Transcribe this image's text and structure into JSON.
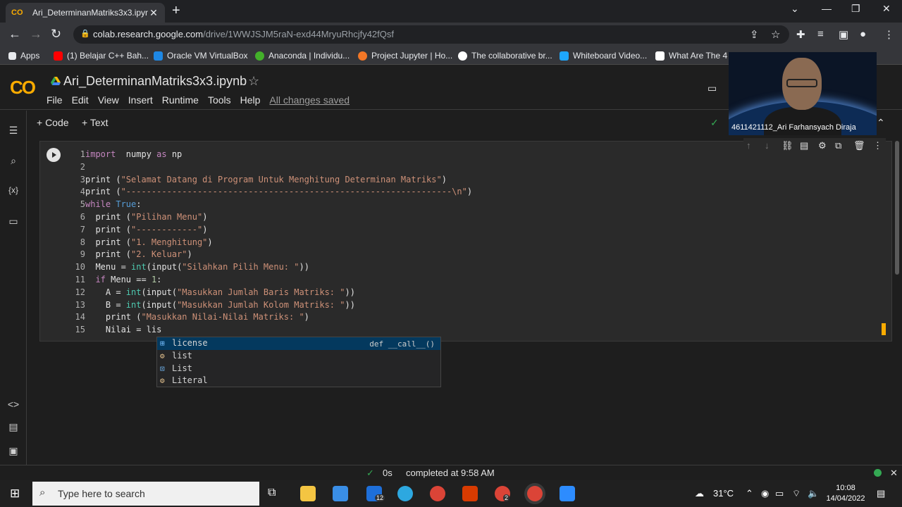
{
  "browser": {
    "tab_title": "Ari_DeterminanMatriks3x3.ipynb",
    "tab_logo": "CO",
    "url_domain": "colab.research.google.com",
    "url_path": "/drive/1WWJSJM5raN-exd44MryuRhcjfy42fQsf"
  },
  "bookmarks": [
    {
      "label": "Apps",
      "color": "#e8eaed"
    },
    {
      "label": "(1) Belajar C++ Bah...",
      "color": "#ff0000"
    },
    {
      "label": "Oracle VM VirtualBox",
      "color": "#1e88e5"
    },
    {
      "label": "Anaconda | Individu...",
      "color": "#43b02a"
    },
    {
      "label": "Project Jupyter | Ho...",
      "color": "#f37726"
    },
    {
      "label": "The collaborative br...",
      "color": "#ffffff"
    },
    {
      "label": "Whiteboard Video...",
      "color": "#1ea7fd"
    },
    {
      "label": "What Are The 4 D",
      "color": "#ffffff"
    }
  ],
  "colab": {
    "logo": "CO",
    "notebook_title": "Ari_DeterminanMatriks3x3.ipynb",
    "menu": [
      "File",
      "Edit",
      "View",
      "Insert",
      "Runtime",
      "Tools",
      "Help"
    ],
    "saved_status": "All changes saved",
    "add_code": "+ Code",
    "add_text": "+ Text"
  },
  "cell": {
    "line_numbers": [
      "1",
      "2",
      "3",
      "4",
      "5",
      "6",
      "7",
      "8",
      "9",
      "10",
      "11",
      "12",
      "13",
      "14",
      "15"
    ]
  },
  "autocomplete": {
    "items": [
      "license",
      "list",
      "List",
      "Literal"
    ],
    "selected_detail": "def __call__()"
  },
  "webcam": {
    "label": "4611421112_Ari Farhansyach Diraja"
  },
  "status": {
    "check": "✓",
    "duration": "0s",
    "completed": "completed at 9:58 AM"
  },
  "taskbar": {
    "search_placeholder": "Type here to search",
    "temperature": "31°C",
    "time": "10:08",
    "date": "14/04/2022",
    "badge": "12",
    "badge2": "2"
  }
}
